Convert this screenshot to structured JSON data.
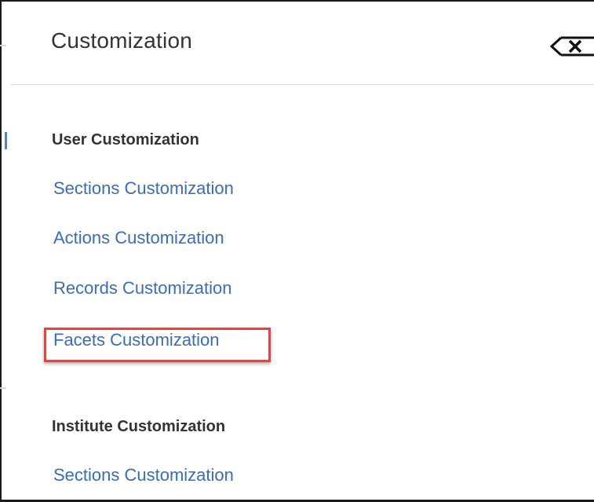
{
  "panel": {
    "title": "Customization",
    "close_icon": "close-icon"
  },
  "user_customization": {
    "heading": "User Customization",
    "links": [
      "Sections Customization",
      "Actions Customization",
      "Records Customization",
      "Facets Customization"
    ]
  },
  "institute_customization": {
    "heading": "Institute Customization",
    "links": [
      "Sections Customization"
    ]
  },
  "colors": {
    "link": "#3a6db5",
    "highlight": "#e04646",
    "text": "#333333"
  }
}
